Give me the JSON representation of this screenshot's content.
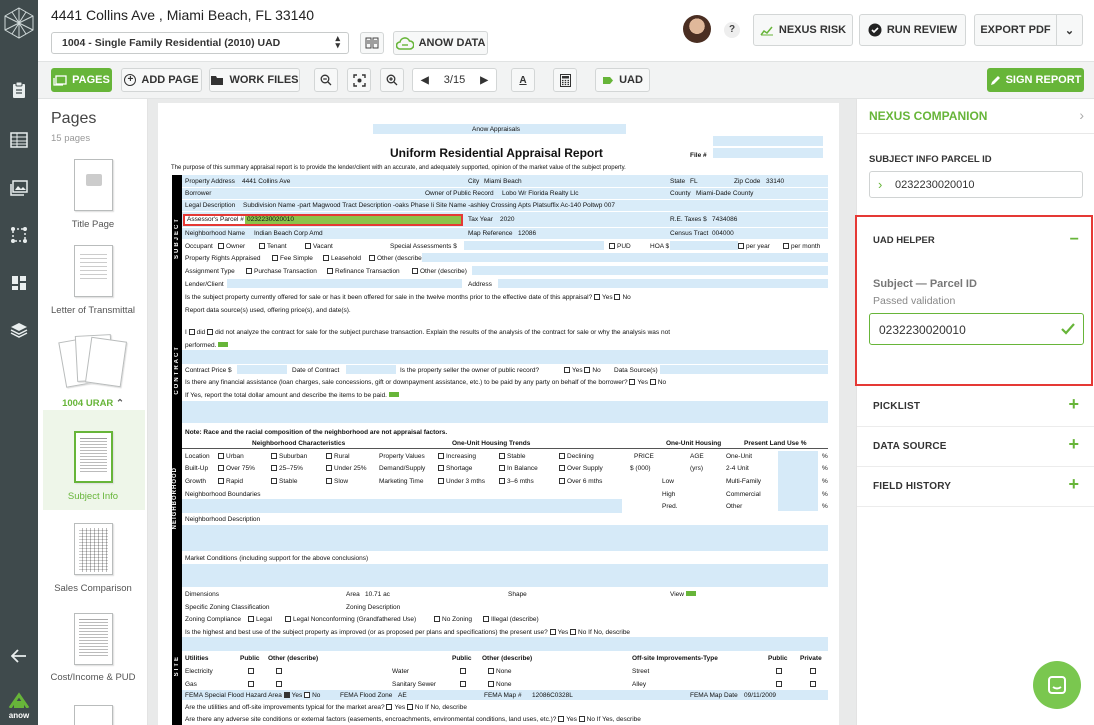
{
  "header": {
    "address": "4441 Collins Ave , Miami Beach, FL 33140",
    "form_select": "1004 - Single Family Residential (2010) UAD",
    "anow_data_label": "ANOW DATA",
    "help_label": "?",
    "nexus_risk_label": "NEXUS RISK",
    "run_review_label": "RUN REVIEW",
    "export_pdf_label": "EXPORT PDF"
  },
  "toolbar": {
    "pages_label": "PAGES",
    "add_page_label": "ADD PAGE",
    "work_files_label": "WORK FILES",
    "page_indicator": "3/15",
    "uad_label": "UAD",
    "sign_report_label": "SIGN REPORT"
  },
  "pages_panel": {
    "title": "Pages",
    "count": "15 pages",
    "items": [
      {
        "label": "Title Page"
      },
      {
        "label": "Letter of Transmittal"
      },
      {
        "label": "1004 URAR"
      },
      {
        "label": "Subject Info"
      },
      {
        "label": "Sales Comparison"
      },
      {
        "label": "Cost/Income & PUD"
      }
    ]
  },
  "rail": {
    "logo_text": "anow"
  },
  "form": {
    "top_banner": "Anow Appraisals",
    "title": "Uniform Residential Appraisal Report",
    "file_no_label": "File #",
    "purpose": "The purpose of this summary appraisal report is to provide the lender/client with an accurate, and adequately supported, opinion of the market value of the subject property.",
    "subject_label": "SUBJECT",
    "contract_label": "CONTRACT",
    "neighborhood_label": "NEIGHBORHOOD",
    "site_label": "SITE",
    "property_address_label": "Property Address",
    "property_address": "4441 Collins Ave",
    "city_label": "City",
    "city": "Miami Beach",
    "state_label": "State",
    "state": "FL",
    "zip_label": "Zip Code",
    "zip": "33140",
    "borrower_label": "Borrower",
    "owner_label": "Owner of Public Record",
    "owner": "Lobo Wr Florida Realty Llc",
    "county_label": "County",
    "county": "Miami-Dade County",
    "legal_label": "Legal Description",
    "legal": "Subdivision Name -part Magwood Tract Description -oaks Phase Ii Site Name -ashley Crossing Apts Platsuffix Ac-140 Poltwp 007",
    "parcel_label": "Assessor's Parcel #",
    "parcel": "0232230020010",
    "tax_year_label": "Tax Year",
    "tax_year": "2020",
    "re_taxes_label": "R.E. Taxes $",
    "re_taxes": "7434086",
    "nbhd_name_label": "Neighborhood Name",
    "nbhd_name": "Indian Beach Corp Amd",
    "map_ref_label": "Map Reference",
    "map_ref": "12086",
    "census_label": "Census Tract",
    "census": "004000",
    "occupant_row": [
      "Occupant",
      "Owner",
      "Tenant",
      "Vacant",
      "Special Assessments $",
      "PUD",
      "HOA $",
      "per year",
      "per month"
    ],
    "rights_row": [
      "Property Rights Appraised",
      "Fee Simple",
      "Leasehold",
      "Other (describe)"
    ],
    "assignment_row": [
      "Assignment Type",
      "Purchase Transaction",
      "Refinance Transaction",
      "Other (describe)"
    ],
    "lender_label": "Lender/Client",
    "address_label": "Address",
    "offered_q": "Is the subject property currently offered for sale or has it been offered for sale in the twelve months prior to the effective date of this appraisal?",
    "yes": "Yes",
    "no": "No",
    "report_sources": "Report data source(s) used, offering price(s), and date(s).",
    "i_did": "I",
    "did": "did",
    "did_not": "did not analyze the contract for sale for the subject purchase transaction. Explain the results of the analysis of the contract for sale or why the analysis was not",
    "performed": "performed.",
    "contract_price": "Contract Price $",
    "date_contract": "Date of Contract",
    "seller_q": "Is the property seller the owner of public record?",
    "data_sources": "Data Source(s)",
    "assist_q": "Is there any financial assistance (loan charges, sale concessions, gift or downpayment assistance, etc.) to be paid by any party on behalf of the borrower?",
    "if_yes_report": "If Yes, report the total dollar amount and describe the items to be paid.",
    "race_note": "Note: Race and the racial composition of the neighborhood are not appraisal factors.",
    "nbhd_char": "Neighborhood Characteristics",
    "one_unit_trends": "One-Unit Housing Trends",
    "one_unit_housing": "One-Unit Housing",
    "land_use": "Present Land Use %",
    "location_row": [
      "Location",
      "Urban",
      "Suburban",
      "Rural",
      "Property Values",
      "Increasing",
      "Stable",
      "Declining",
      "PRICE",
      "AGE",
      "One-Unit",
      "%"
    ],
    "builtup_row": [
      "Built-Up",
      "Over 75%",
      "25–75%",
      "Under 25%",
      "Demand/Supply",
      "Shortage",
      "In Balance",
      "Over Supply",
      "$ (000)",
      "(yrs)",
      "2-4 Unit",
      "%"
    ],
    "growth_row": [
      "Growth",
      "Rapid",
      "Stable",
      "Slow",
      "Marketing Time",
      "Under 3 mths",
      "3–6 mths",
      "Over 6 mths",
      "Low",
      "Multi-Family",
      "%"
    ],
    "boundaries": "Neighborhood Boundaries",
    "high": "High",
    "commercial": "Commercial",
    "pred": "Pred.",
    "other": "Other",
    "pct": "%",
    "nbhd_desc": "Neighborhood Description",
    "market_cond": "Market Conditions (including support for the above conclusions)",
    "dimensions": "Dimensions",
    "area_label": "Area",
    "area": "10.71 ac",
    "shape": "Shape",
    "view": "View",
    "zoning_class": "Specific Zoning Classification",
    "zoning_desc": "Zoning Description",
    "zoning_row": [
      "Zoning Compliance",
      "Legal",
      "Legal Nonconforming (Grandfathered Use)",
      "No Zoning",
      "Illegal (describe)"
    ],
    "hbu_q": "Is the highest and best use of the subject property as improved (or as proposed per plans and specifications) the present use?",
    "if_no_describe": "If No, describe",
    "utilities": "Utilities",
    "public": "Public",
    "other_describe": "Other (describe)",
    "offsite": "Off-site Improvements-Type",
    "private": "Private",
    "electricity": "Electricity",
    "water": "Water",
    "none": "None",
    "street": "Street",
    "gas": "Gas",
    "sewer": "Sanitary Sewer",
    "alley": "Alley",
    "flood_hazard": "FEMA Special Flood Hazard Area",
    "flood_zone_label": "FEMA Flood Zone",
    "flood_zone": "AE",
    "fema_map_label": "FEMA Map #",
    "fema_map": "12086C0328L",
    "fema_date_label": "FEMA Map Date",
    "fema_date": "09/11/2009",
    "utilities_q": "Are the utilities and off-site improvements typical for the market area?",
    "adverse_q": "Are there any adverse site conditions or external factors (easements, encroachments, environmental conditions, land uses, etc.)?",
    "if_yes_describe": "If Yes, describe"
  },
  "companion": {
    "title": "NEXUS COMPANION",
    "parcel_section_label": "SUBJECT INFO PARCEL ID",
    "parcel_value": "0232230020010",
    "uad_helper_label": "UAD HELPER",
    "field_title": "Subject — Parcel ID",
    "status": "Passed validation",
    "field_value": "0232230020010",
    "sections": [
      "PICKLIST",
      "DATA SOURCE",
      "FIELD HISTORY"
    ]
  },
  "colors": {
    "brand_green": "#67b539",
    "rail": "#3f4a4c",
    "form_blue": "#d6eaf8",
    "highlight_red": "#e53935"
  }
}
